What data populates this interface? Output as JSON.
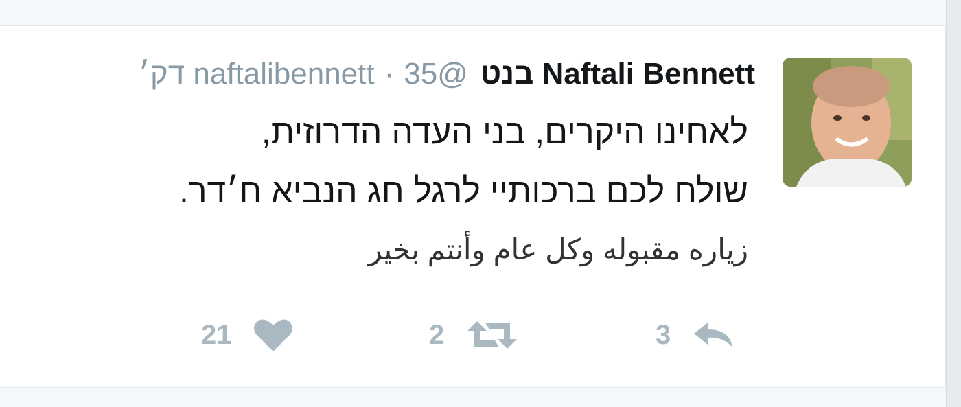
{
  "tweet": {
    "author_name": "Naftali Bennett בנט",
    "handle": "@naftalibennett",
    "separator": "·",
    "timestamp": "35 דק׳",
    "lines": [
      "לאחינו היקרים, בני העדה הדרוזית,",
      "שולח לכם ברכותיי לרגל חג הנביא ח׳דר.",
      "زياره مقبوله وكل عام وأنتم بخير"
    ]
  },
  "actions": {
    "reply": {
      "icon": "reply-icon",
      "count": "3"
    },
    "retweet": {
      "icon": "retweet-icon",
      "count": "2"
    },
    "like": {
      "icon": "heart-icon",
      "count": "21"
    }
  },
  "colors": {
    "text": "#14171a",
    "secondary": "#8899a6",
    "action_icon": "#aab8c2",
    "background": "#f5f8fa",
    "card": "#ffffff"
  }
}
